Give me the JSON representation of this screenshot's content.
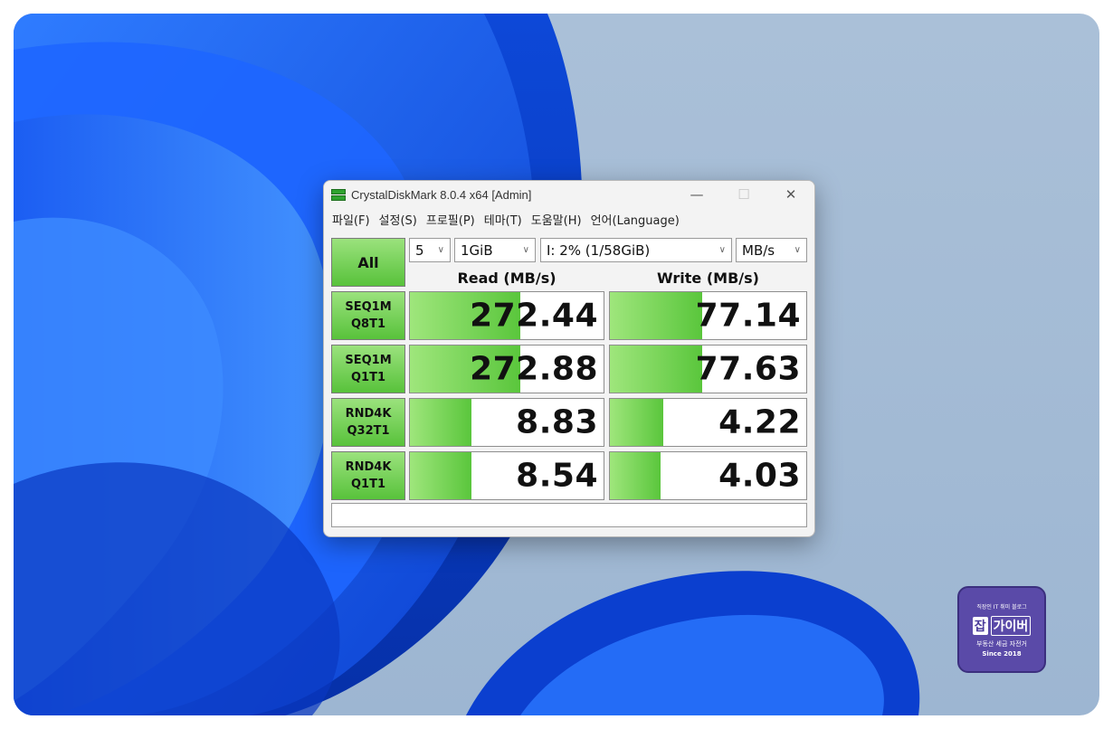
{
  "window": {
    "title": "CrystalDiskMark 8.0.4 x64 [Admin]",
    "controls": {
      "minimize": "—",
      "maximize": "☐",
      "close": "✕"
    }
  },
  "menu": [
    "파일(F)",
    "설정(S)",
    "프로필(P)",
    "테마(T)",
    "도움말(H)",
    "언어(Language)"
  ],
  "toolbar": {
    "all_label": "All",
    "count": "5",
    "size": "1GiB",
    "drive": "I: 2% (1/58GiB)",
    "unit": "MB/s"
  },
  "columns": {
    "read": "Read (MB/s)",
    "write": "Write (MB/s)"
  },
  "tests": [
    {
      "line1": "SEQ1M",
      "line2": "Q8T1",
      "read": "272.44",
      "write": "77.14",
      "read_fill": 0.57,
      "write_fill": 0.47
    },
    {
      "line1": "SEQ1M",
      "line2": "Q1T1",
      "read": "272.88",
      "write": "77.63",
      "read_fill": 0.57,
      "write_fill": 0.47
    },
    {
      "line1": "RND4K",
      "line2": "Q32T1",
      "read": "8.83",
      "write": "4.22",
      "read_fill": 0.32,
      "write_fill": 0.27
    },
    {
      "line1": "RND4K",
      "line2": "Q1T1",
      "read": "8.54",
      "write": "4.03",
      "read_fill": 0.32,
      "write_fill": 0.26
    }
  ],
  "status_text": "",
  "badge": {
    "top": "직장인 IT 취미 블로그",
    "jam": "잡",
    "name": "가이버",
    "sub": "부동산 세금 자전거",
    "since": "Since 2018"
  }
}
